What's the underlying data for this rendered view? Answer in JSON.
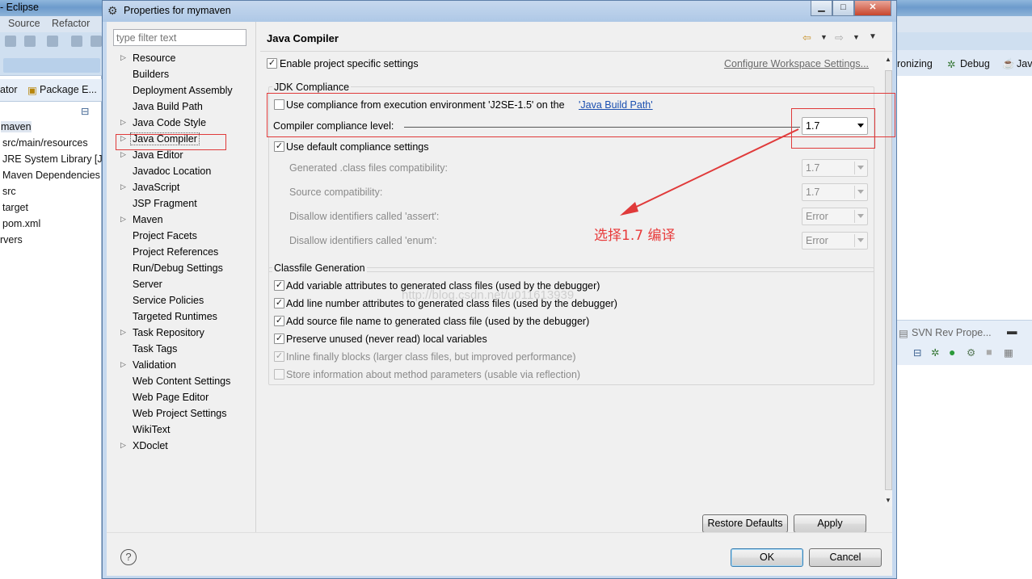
{
  "background": {
    "window_title": "- Eclipse",
    "menu": [
      "Source",
      "Refactor"
    ],
    "left_tab_1": "ator",
    "left_tab_2": "Package E...",
    "left_tree": [
      "maven",
      "src/main/resources",
      "JRE System Library [J",
      "Maven Dependencies",
      "src",
      "target",
      "pom.xml",
      "rvers"
    ],
    "right_toolbar": [
      "ronizing",
      "Debug",
      "Jav"
    ],
    "right_mid_title": "SVN Rev Prope..."
  },
  "dialog": {
    "title": "Properties for mymaven",
    "filter_placeholder": "type filter text",
    "tree": [
      {
        "label": "Resource",
        "arrow": true
      },
      {
        "label": "Builders",
        "arrow": false
      },
      {
        "label": "Deployment Assembly",
        "arrow": false
      },
      {
        "label": "Java Build Path",
        "arrow": false
      },
      {
        "label": "Java Code Style",
        "arrow": true
      },
      {
        "label": "Java Compiler",
        "arrow": true,
        "selected": true
      },
      {
        "label": "Java Editor",
        "arrow": true
      },
      {
        "label": "Javadoc Location",
        "arrow": false
      },
      {
        "label": "JavaScript",
        "arrow": true
      },
      {
        "label": "JSP Fragment",
        "arrow": false
      },
      {
        "label": "Maven",
        "arrow": true
      },
      {
        "label": "Project Facets",
        "arrow": false
      },
      {
        "label": "Project References",
        "arrow": false
      },
      {
        "label": "Run/Debug Settings",
        "arrow": false
      },
      {
        "label": "Server",
        "arrow": false
      },
      {
        "label": "Service Policies",
        "arrow": false
      },
      {
        "label": "Targeted Runtimes",
        "arrow": false
      },
      {
        "label": "Task Repository",
        "arrow": true
      },
      {
        "label": "Task Tags",
        "arrow": false
      },
      {
        "label": "Validation",
        "arrow": true
      },
      {
        "label": "Web Content Settings",
        "arrow": false
      },
      {
        "label": "Web Page Editor",
        "arrow": false
      },
      {
        "label": "Web Project Settings",
        "arrow": false
      },
      {
        "label": "WikiText",
        "arrow": false
      },
      {
        "label": "XDoclet",
        "arrow": true
      }
    ],
    "page_title": "Java Compiler",
    "enable_project_specific": {
      "label": "Enable project specific settings",
      "checked": true
    },
    "configure_workspace_link": "Configure Workspace Settings...",
    "jdk_group": {
      "title": "JDK Compliance",
      "use_env_prefix": "Use compliance from execution environment 'J2SE-1.5' on the ",
      "use_env_link": "'Java Build Path'",
      "use_env_checked": false,
      "compliance_label": "Compiler compliance level:",
      "compliance_value": "1.7",
      "use_default": {
        "label": "Use default compliance settings",
        "checked": true
      },
      "generated_label": "Generated .class files compatibility:",
      "generated_value": "1.7",
      "source_label": "Source compatibility:",
      "source_value": "1.7",
      "assert_label": "Disallow identifiers called 'assert':",
      "assert_value": "Error",
      "enum_label": "Disallow identifiers called 'enum':",
      "enum_value": "Error"
    },
    "classfile_group": {
      "title": "Classfile Generation",
      "options": [
        {
          "label": "Add variable attributes to generated class files (used by the debugger)",
          "checked": true,
          "enabled": true
        },
        {
          "label": "Add line number attributes to generated class files (used by the debugger)",
          "checked": true,
          "enabled": true
        },
        {
          "label": "Add source file name to generated class file (used by the debugger)",
          "checked": true,
          "enabled": true
        },
        {
          "label": "Preserve unused (never read) local variables",
          "checked": true,
          "enabled": true
        },
        {
          "label": "Inline finally blocks (larger class files, but improved performance)",
          "checked": true,
          "enabled": false
        },
        {
          "label": "Store information about method parameters (usable via reflection)",
          "checked": false,
          "enabled": false
        }
      ]
    },
    "restore_defaults": "Restore Defaults",
    "apply": "Apply",
    "ok": "OK",
    "cancel": "Cancel"
  },
  "annotation": {
    "text": "选择1.7  编译",
    "color": "#e83a3a",
    "watermark": "http://blog.csdn.net/u011613939"
  },
  "colors": {
    "annotation_red": "#e03a3a",
    "link": "#1a4fb0"
  }
}
